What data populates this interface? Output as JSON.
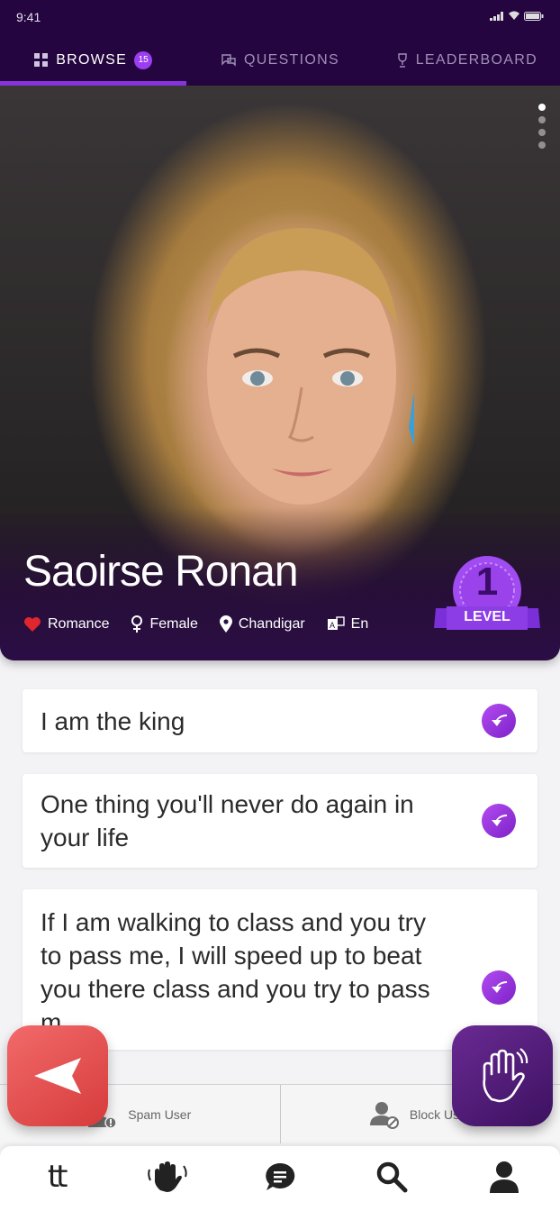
{
  "status": {
    "time": "9:41"
  },
  "tabs": [
    {
      "label": "BROWSE",
      "badge": "15",
      "icon": "grid-icon",
      "active": true
    },
    {
      "label": "QUESTIONS",
      "icon": "chat-bubbles-icon",
      "active": false
    },
    {
      "label": "LEADERBOARD",
      "icon": "trophy-icon",
      "active": false
    }
  ],
  "profile": {
    "name": "Saoirse Ronan",
    "interest": "Romance",
    "gender": "Female",
    "location": "Chandigar",
    "language": "En",
    "level_number": "1",
    "level_label": "LEVEL"
  },
  "questions": [
    "I am the king",
    "One thing you'll never do again in your life",
    "If I am walking to class and you try to pass me, I will speed up to beat you there class and you try to pass m...."
  ],
  "actions": {
    "spam": "Spam User",
    "block": "Block User"
  },
  "nav": {
    "logo": "tt"
  },
  "colors": {
    "header_bg": "#24053f",
    "accent": "#8a35e0",
    "back_button": "#e14f4f",
    "wave_button": "#4e1a76"
  }
}
